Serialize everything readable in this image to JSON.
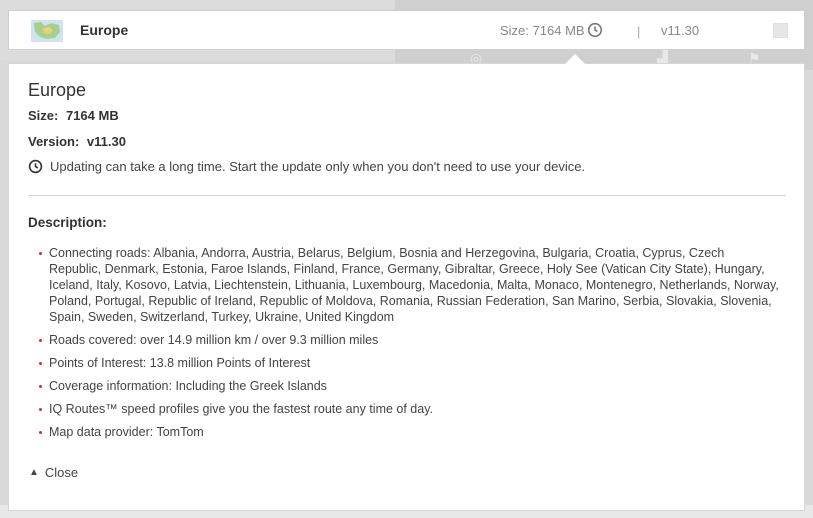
{
  "header": {
    "region_name": "Europe",
    "size_label": "Size:",
    "size_value": "7164 MB",
    "separator": "|",
    "version": "v11.30"
  },
  "panel": {
    "title": "Europe",
    "size_label": "Size:",
    "size_value": "7164 MB",
    "version_label": "Version:",
    "version_value": "v11.30",
    "warning": "Updating can take a long time. Start the update only when you don't need to use your device.",
    "description_label": "Description:",
    "description_items": [
      "Connecting roads: Albania, Andorra, Austria, Belarus, Belgium, Bosnia and Herzegovina, Bulgaria, Croatia, Cyprus, Czech Republic, Denmark, Estonia, Faroe Islands, Finland, France, Germany, Gibraltar, Greece, Holy See (Vatican City State), Hungary, Iceland, Italy, Kosovo, Latvia, Liechtenstein, Lithuania, Luxembourg, Macedonia, Malta, Monaco, Montenegro, Netherlands, Norway, Poland, Portugal, Republic of Ireland, Republic of Moldova, Romania, Russian Federation, San Marino, Serbia, Slovakia, Slovenia, Spain, Sweden, Switzerland, Turkey, Ukraine, United Kingdom",
      "Roads covered: over 14.9 million km / over 9.3 million miles",
      "Points of Interest: 13.8 million Points of Interest",
      "Coverage information: Including the Greek Islands",
      "IQ Routes™ speed profiles give you the fastest route any time of day.",
      "Map data provider: TomTom"
    ],
    "close_label": "Close"
  },
  "colors": {
    "bullet": "#c0392b",
    "panel_bg": "#ffffff",
    "page_bg": "#d9d9d9"
  }
}
